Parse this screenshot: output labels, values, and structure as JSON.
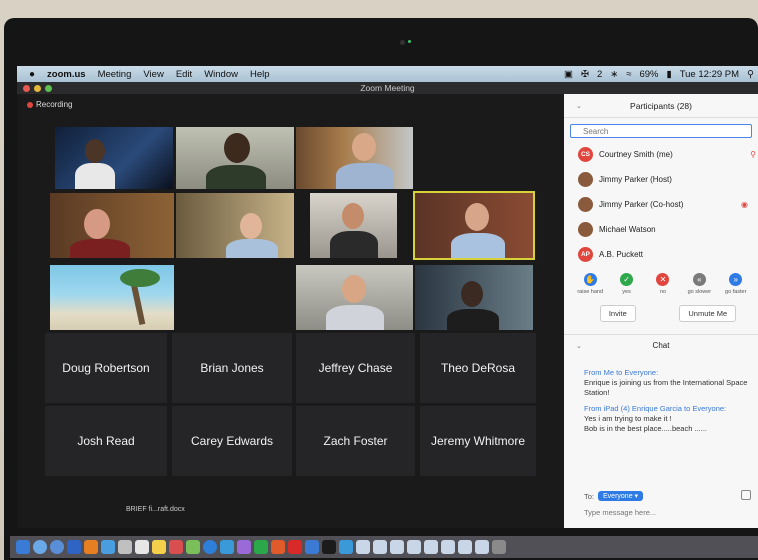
{
  "menubar": {
    "apple": "",
    "app": "zoom.us",
    "items": [
      "Meeting",
      "View",
      "Edit",
      "Window",
      "Help"
    ],
    "status_items": [
      "2",
      "69%",
      "Tue 12:29 PM"
    ]
  },
  "window": {
    "title": "Zoom Meeting"
  },
  "recording": {
    "label": "Recording"
  },
  "video_names": {
    "row4": [
      "Doug Robertson",
      "Brian Jones",
      "Jeffrey Chase",
      "Theo DeRosa"
    ],
    "row5": [
      "Josh Read",
      "Carey Edwards",
      "Zach Foster",
      "Jeremy Whitmore"
    ]
  },
  "participants": {
    "title": "Participants (28)",
    "search_placeholder": "Search",
    "list": [
      {
        "initials": "CS",
        "name": "Courtney Smith (me)",
        "avatar_color": "#e0463e"
      },
      {
        "initials": "",
        "name": "Jimmy Parker (Host)",
        "avatar_color": "#8a5a3c"
      },
      {
        "initials": "",
        "name": "Jimmy Parker (Co-host)",
        "avatar_color": "#8a5a3c"
      },
      {
        "initials": "",
        "name": "Michael Watson",
        "avatar_color": "#8a5a3c"
      },
      {
        "initials": "AP",
        "name": "A.B. Puckett",
        "avatar_color": "#e0463e"
      }
    ],
    "reactions": [
      {
        "label": "raise hand",
        "icon": "hand-icon",
        "color": "#2f7be5",
        "glyph": "✋"
      },
      {
        "label": "yes",
        "icon": "check-icon",
        "color": "#2ea84a",
        "glyph": "✓"
      },
      {
        "label": "no",
        "icon": "x-icon",
        "color": "#e0463e",
        "glyph": "✕"
      },
      {
        "label": "go slower",
        "icon": "rewind-icon",
        "color": "#7a7a7a",
        "glyph": "«"
      },
      {
        "label": "go faster",
        "icon": "fast-forward-icon",
        "color": "#2f7be5",
        "glyph": "»"
      }
    ],
    "invite_label": "Invite",
    "unmute_label": "Unmute Me"
  },
  "chat": {
    "title": "Chat",
    "messages": [
      {
        "from": "From Me to Everyone:",
        "text": "Enrique is joining us from the International Space Station!"
      },
      {
        "from": "From iPad (4) Enrique Garcia to Everyone:",
        "text": "Yes i am trying to make it !"
      },
      {
        "from": "",
        "text": "Bob is in the best place.....beach ......"
      }
    ],
    "to_label": "To:",
    "to_value": "Everyone ▾",
    "input_placeholder": "Type message here..."
  },
  "dock": {
    "doc_label": "BRIEF fi...raft.docx"
  },
  "colors": {
    "accent": "#2f7be5",
    "record": "#e0463e",
    "active_speaker": "#d8d23a"
  }
}
